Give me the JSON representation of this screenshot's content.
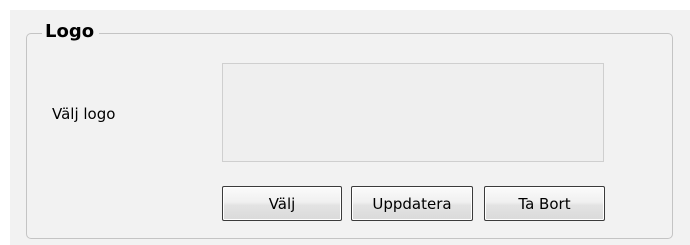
{
  "group": {
    "title": "Logo"
  },
  "field": {
    "label": "Välj logo"
  },
  "buttons": {
    "choose_label": "Välj",
    "update_label": "Uppdatera",
    "remove_label": "Ta Bort"
  }
}
